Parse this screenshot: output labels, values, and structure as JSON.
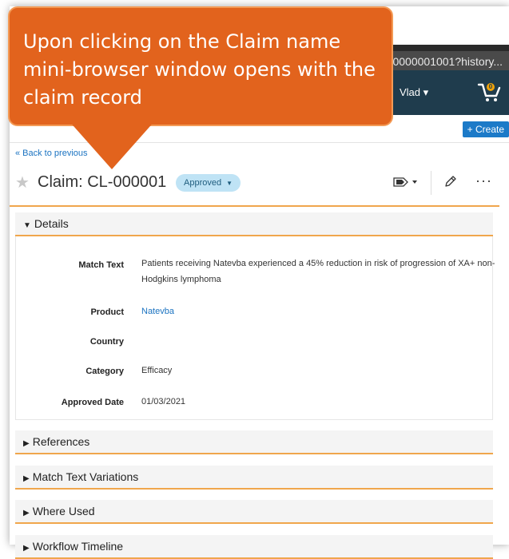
{
  "browser": {
    "url_fragment": "0000001001?history..."
  },
  "header": {
    "user_label": "Vlad ▾",
    "cart_badge": "0"
  },
  "toolbar": {
    "create_label": "+ Create"
  },
  "record": {
    "back_label": "« Back to previous",
    "title": "Claim: CL-000001",
    "status": "Approved",
    "status_caret": "▼"
  },
  "details": {
    "section_label": "Details",
    "fields": [
      {
        "label": "Match Text",
        "value": "Patients receiving Natevba experienced a 45% reduction in risk of progression of XA+ non-Hodgkins lymphoma"
      },
      {
        "label": "Product",
        "value": "Natevba"
      },
      {
        "label": "Country",
        "value": ""
      },
      {
        "label": "Category",
        "value": "Efficacy"
      },
      {
        "label": "Approved Date",
        "value": "01/03/2021"
      }
    ]
  },
  "sections": [
    {
      "label": "References"
    },
    {
      "label": "Match Text Variations"
    },
    {
      "label": "Where Used"
    },
    {
      "label": "Workflow Timeline"
    }
  ],
  "callout": {
    "text": "Upon clicking on the Claim name mini-browser window opens with the claim record"
  },
  "icons": {
    "star": "star-icon",
    "tag": "tag-dropdown-icon",
    "pencil": "pencil-icon",
    "more": "more-icon",
    "cart": "cart-icon",
    "caret_down": "caret-down-icon",
    "caret_right": "caret-right-icon"
  },
  "colors": {
    "accent": "#f0a64c",
    "callout": "#e2631d",
    "appbar": "#1f3c4d",
    "link": "#1b73c1",
    "status_bg": "#bfe3f5"
  }
}
